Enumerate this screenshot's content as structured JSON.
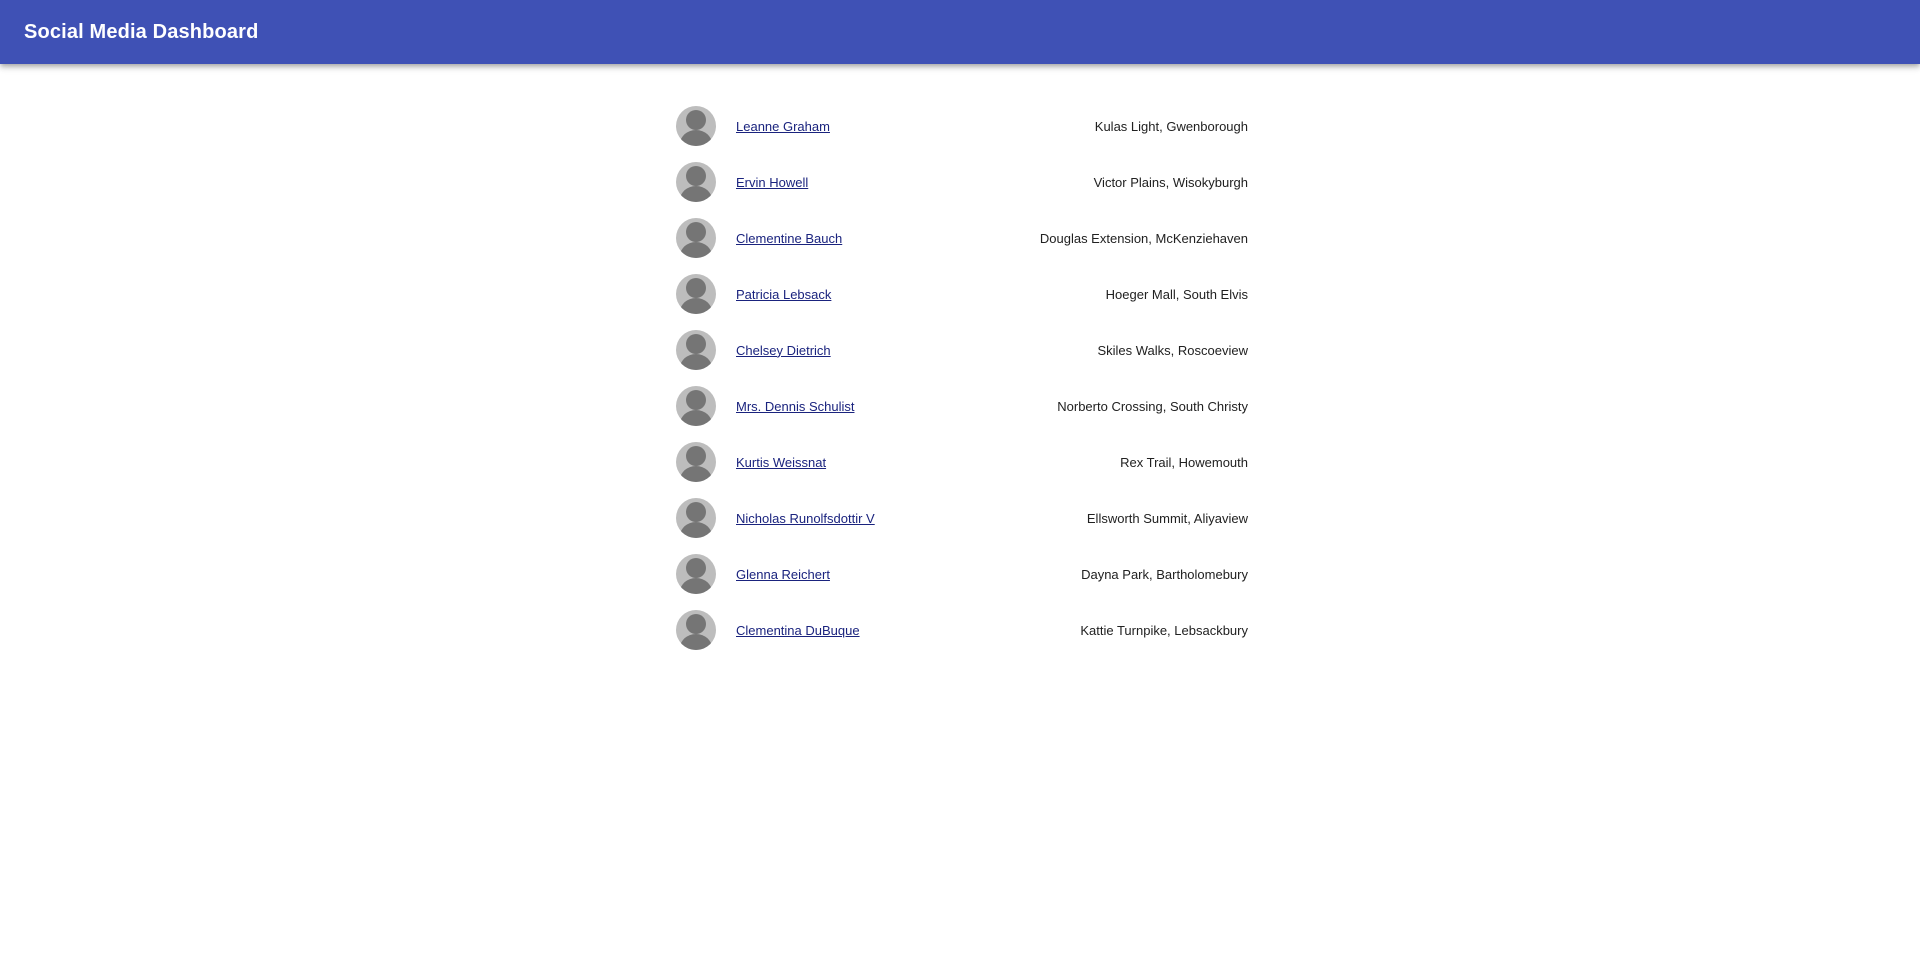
{
  "app": {
    "title": "Social Media Dashboard",
    "accent_color": "#3f51b5"
  },
  "users": [
    {
      "name": "Leanne Graham",
      "address": "Kulas Light, Gwenborough",
      "avatar_icon": "person-avatar-icon"
    },
    {
      "name": "Ervin Howell",
      "address": "Victor Plains, Wisokyburgh",
      "avatar_icon": "person-avatar-icon"
    },
    {
      "name": "Clementine Bauch",
      "address": "Douglas Extension, McKenziehaven",
      "avatar_icon": "person-avatar-icon"
    },
    {
      "name": "Patricia Lebsack",
      "address": "Hoeger Mall, South Elvis",
      "avatar_icon": "person-avatar-icon"
    },
    {
      "name": "Chelsey Dietrich",
      "address": "Skiles Walks, Roscoeview",
      "avatar_icon": "person-avatar-icon"
    },
    {
      "name": "Mrs. Dennis Schulist",
      "address": "Norberto Crossing, South Christy",
      "avatar_icon": "person-avatar-icon"
    },
    {
      "name": "Kurtis Weissnat",
      "address": "Rex Trail, Howemouth",
      "avatar_icon": "person-avatar-icon"
    },
    {
      "name": "Nicholas Runolfsdottir V",
      "address": "Ellsworth Summit, Aliyaview",
      "avatar_icon": "person-avatar-icon"
    },
    {
      "name": "Glenna Reichert",
      "address": "Dayna Park, Bartholomebury",
      "avatar_icon": "person-avatar-icon"
    },
    {
      "name": "Clementina DuBuque",
      "address": "Kattie Turnpike, Lebsackbury",
      "avatar_icon": "person-avatar-icon"
    }
  ]
}
